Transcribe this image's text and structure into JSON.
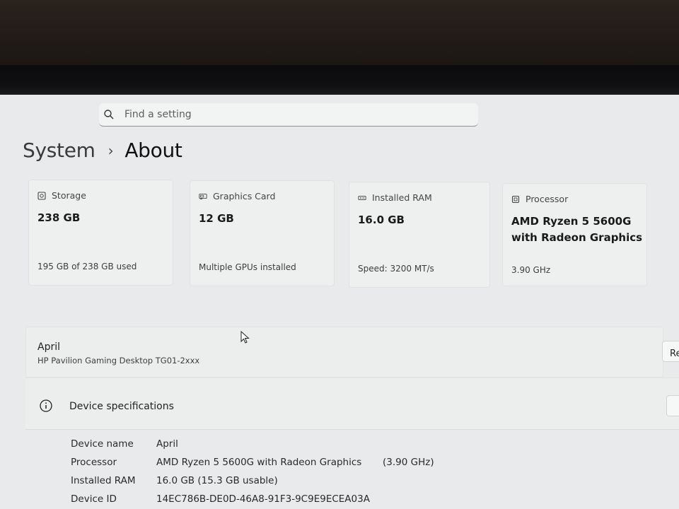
{
  "search": {
    "placeholder": "Find a setting"
  },
  "breadcrumb": {
    "parent": "System",
    "separator": "›",
    "current": "About"
  },
  "cards": [
    {
      "icon": "storage-icon",
      "label": "Storage",
      "value": "238 GB",
      "detail": "195 GB of 238 GB used"
    },
    {
      "icon": "graphics-card-icon",
      "label": "Graphics Card",
      "value": "12 GB",
      "detail": "Multiple GPUs installed"
    },
    {
      "icon": "ram-icon",
      "label": "Installed RAM",
      "value": "16.0 GB",
      "detail": "Speed: 3200 MT/s"
    },
    {
      "icon": "processor-icon",
      "label": "Processor",
      "value_line1": "AMD Ryzen 5 5600G",
      "value_line2": "with Radeon Graphics",
      "detail": "3.90 GHz"
    }
  ],
  "device": {
    "name": "April",
    "model": "HP Pavilion Gaming Desktop TG01-2xxx",
    "rename_label": "Re"
  },
  "specifications": {
    "title": "Device specifications",
    "rows": [
      {
        "label": "Device name",
        "value": "April",
        "extra": ""
      },
      {
        "label": "Processor",
        "value": "AMD Ryzen 5 5600G with Radeon Graphics",
        "extra": "(3.90 GHz)"
      },
      {
        "label": "Installed RAM",
        "value": "16.0 GB (15.3 GB usable)",
        "extra": ""
      },
      {
        "label": "Device ID",
        "value": "14EC786B-DE0D-46A8-91F3-9C9E9ECEA03A",
        "extra": ""
      }
    ]
  }
}
